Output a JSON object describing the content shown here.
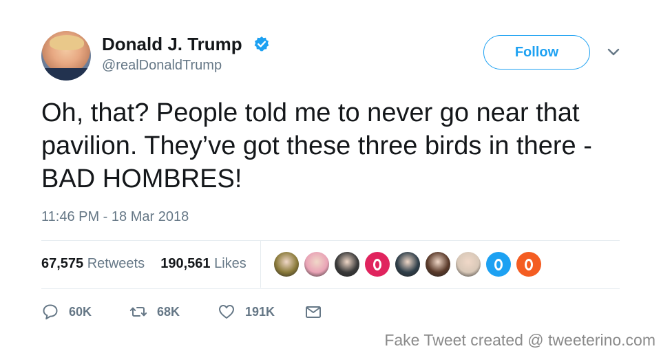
{
  "author": {
    "name": "Donald J. Trump",
    "handle": "@realDonaldTrump"
  },
  "header": {
    "follow_label": "Follow"
  },
  "tweet": {
    "text": "Oh, that? People told me to never go near that pavilion. They’ve got these three birds in there - BAD HOMBRES!",
    "timestamp": "11:46 PM - 18 Mar 2018"
  },
  "stats": {
    "retweets_count": "67,575",
    "retweets_label": "Retweets",
    "likes_count": "190,561",
    "likes_label": "Likes"
  },
  "likers": [
    {
      "icon": "sign-avatar",
      "color": "#8a7a3a"
    },
    {
      "icon": "person-avatar",
      "color": "#e9a3b6"
    },
    {
      "icon": "person-avatar",
      "color": "#3a3a3a"
    },
    {
      "icon": "opera-avatar",
      "color": "#e0245e"
    },
    {
      "icon": "person-avatar",
      "color": "#2f3f4a"
    },
    {
      "icon": "group-avatar",
      "color": "#5a3a2a"
    },
    {
      "icon": "cartoon-avatar",
      "color": "#d8c8b8"
    },
    {
      "icon": "egg-avatar",
      "color": "#1da1f2"
    },
    {
      "icon": "egg-avatar",
      "color": "#f45d22"
    }
  ],
  "actions": {
    "reply_count": "60K",
    "retweet_count": "68K",
    "like_count": "191K"
  },
  "footer": {
    "text": "Fake Tweet created @ tweeterino.com"
  },
  "colors": {
    "accent": "#1da1f2",
    "text": "#14171a",
    "secondary": "#657786"
  }
}
